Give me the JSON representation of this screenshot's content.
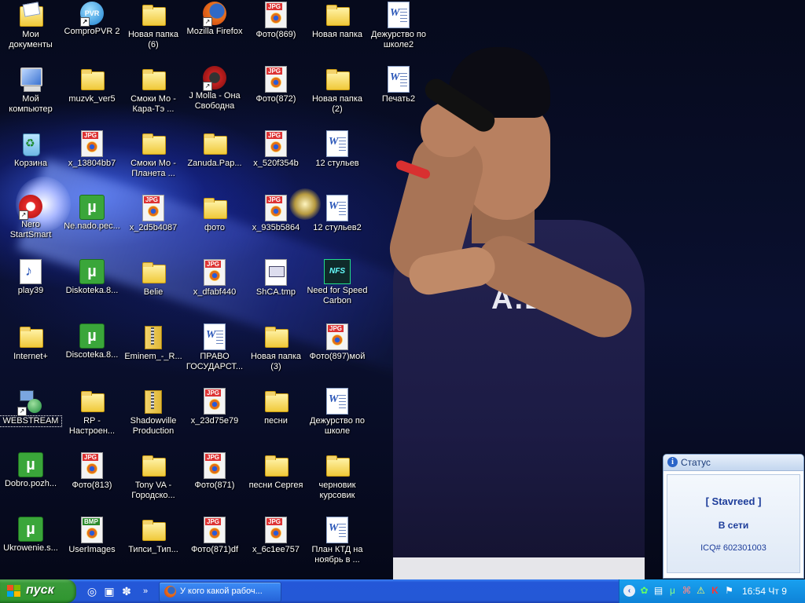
{
  "desktop": {
    "icons": [
      {
        "label": "Мои документы",
        "type": "mydocs"
      },
      {
        "label": "Мой компьютер",
        "type": "computer"
      },
      {
        "label": "Корзина",
        "type": "recycle"
      },
      {
        "label": "Nero StartSmart",
        "type": "nero"
      },
      {
        "label": "play39",
        "type": "audio"
      },
      {
        "label": "Internet+",
        "type": "folder"
      },
      {
        "label": "WEBSTREAM",
        "type": "network"
      },
      {
        "label": "Dobro.pozh...",
        "type": "utorrent"
      },
      {
        "label": "Ukrowenie.s...",
        "type": "utorrent"
      },
      {
        "label": "ComproPVR 2",
        "type": "compro"
      },
      {
        "label": "muzvk_ver5",
        "type": "folder"
      },
      {
        "label": "x_13804bb7",
        "type": "jpg"
      },
      {
        "label": "Ne.nado.pec...",
        "type": "utorrent"
      },
      {
        "label": "Diskoteka.8...",
        "type": "utorrent"
      },
      {
        "label": "Discoteka.8...",
        "type": "utorrent"
      },
      {
        "label": "RP - Настроен...",
        "type": "folder"
      },
      {
        "label": "Фото(813)",
        "type": "jpg"
      },
      {
        "label": "UserImages",
        "type": "bmp"
      },
      {
        "label": "Новая папка (6)",
        "type": "folder"
      },
      {
        "label": "Смоки Мо - Кара-Тэ ...",
        "type": "folder"
      },
      {
        "label": "Смоки Мо - Планета ...",
        "type": "folder"
      },
      {
        "label": "x_2d5b4087",
        "type": "jpg"
      },
      {
        "label": "Belie",
        "type": "folder"
      },
      {
        "label": "Eminem_-_R...",
        "type": "zipfolder"
      },
      {
        "label": "Shadowville Production",
        "type": "zipfolder"
      },
      {
        "label": "Tony VA - Городско...",
        "type": "folder"
      },
      {
        "label": "Типси_Тип...",
        "type": "folder"
      },
      {
        "label": "Mozilla Firefox",
        "type": "firefox"
      },
      {
        "label": "J Molla - Она Свободна",
        "type": "jmolla"
      },
      {
        "label": "Zanuda.Pap...",
        "type": "folder"
      },
      {
        "label": "фото",
        "type": "folder"
      },
      {
        "label": "x_dfabf440",
        "type": "jpg"
      },
      {
        "label": "ПРАВО ГОСУДАРСТ...",
        "type": "doc"
      },
      {
        "label": "x_23d75e79",
        "type": "jpg"
      },
      {
        "label": "Фото(871)",
        "type": "jpg"
      },
      {
        "label": "Фото(871)df",
        "type": "jpg"
      },
      {
        "label": "Фото(869)",
        "type": "jpg"
      },
      {
        "label": "Фото(872)",
        "type": "jpg"
      },
      {
        "label": "x_520f354b",
        "type": "jpg"
      },
      {
        "label": "x_935b5864",
        "type": "jpg"
      },
      {
        "label": "ShCA.tmp",
        "type": "tmp"
      },
      {
        "label": "Новая папка (3)",
        "type": "folder"
      },
      {
        "label": "песни",
        "type": "folder"
      },
      {
        "label": "песни Сергея",
        "type": "folder"
      },
      {
        "label": "x_6c1ee757",
        "type": "jpg"
      },
      {
        "label": "Новая папка",
        "type": "folder"
      },
      {
        "label": "Новая папка (2)",
        "type": "folder"
      },
      {
        "label": "12 стульев",
        "type": "doc"
      },
      {
        "label": "12 стульев2",
        "type": "doc"
      },
      {
        "label": "Need for Speed Carbon",
        "type": "nfs"
      },
      {
        "label": "Фото(897)мой",
        "type": "jpg"
      },
      {
        "label": "Дежурство по школе",
        "type": "doc"
      },
      {
        "label": "черновик курсовик",
        "type": "folder"
      },
      {
        "label": "План КТД на ноябрь в ...",
        "type": "doc"
      },
      {
        "label": "Дежурство по школе2",
        "type": "doc"
      },
      {
        "label": "Печать2",
        "type": "doc"
      }
    ]
  },
  "wallpaper": {
    "shirt_text": "A.B."
  },
  "status_popup": {
    "title": "Статус",
    "name": "[ Stavreed ]",
    "state": "В сети",
    "icq": "ICQ# 602301003"
  },
  "taskbar": {
    "start_label": "пуск",
    "task": "У кого какой рабоч...",
    "clock": "16:54 Чт 9"
  },
  "colors": {
    "taskbar": "#2458d6",
    "start": "#3a9b3a",
    "tray": "#0e83d8"
  }
}
